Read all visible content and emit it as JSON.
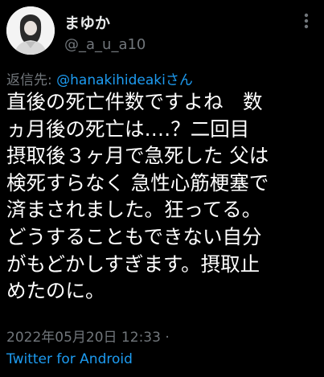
{
  "user": {
    "display_name": "まゆか",
    "handle": "@_a_u_a10",
    "avatar_icon": "profile-photo-icon"
  },
  "menu": {
    "icon": "more-vertical-icon"
  },
  "reply": {
    "prefix": "返信先: ",
    "to_handle": "@hanakihideaki",
    "suffix": "さん"
  },
  "tweet": {
    "lines": [
      "直後の死亡件数ですよね　数",
      "ヵ月後の死亡は‥‥？二回目",
      "摂取後３ヶ月で急死した 父は",
      "検死すらなく 急性心筋梗塞で",
      "済まされました。狂ってる。",
      "どうすることもできない自分",
      "がもどかしすぎます。摂取止",
      "めたのに。"
    ]
  },
  "meta": {
    "timestamp": "2022年05月20日 12:33 ·",
    "source": "Twitter for Android"
  },
  "colors": {
    "background": "#000000",
    "text": "#ffffff",
    "secondary": "#71767b",
    "link": "#1d9bf0"
  }
}
